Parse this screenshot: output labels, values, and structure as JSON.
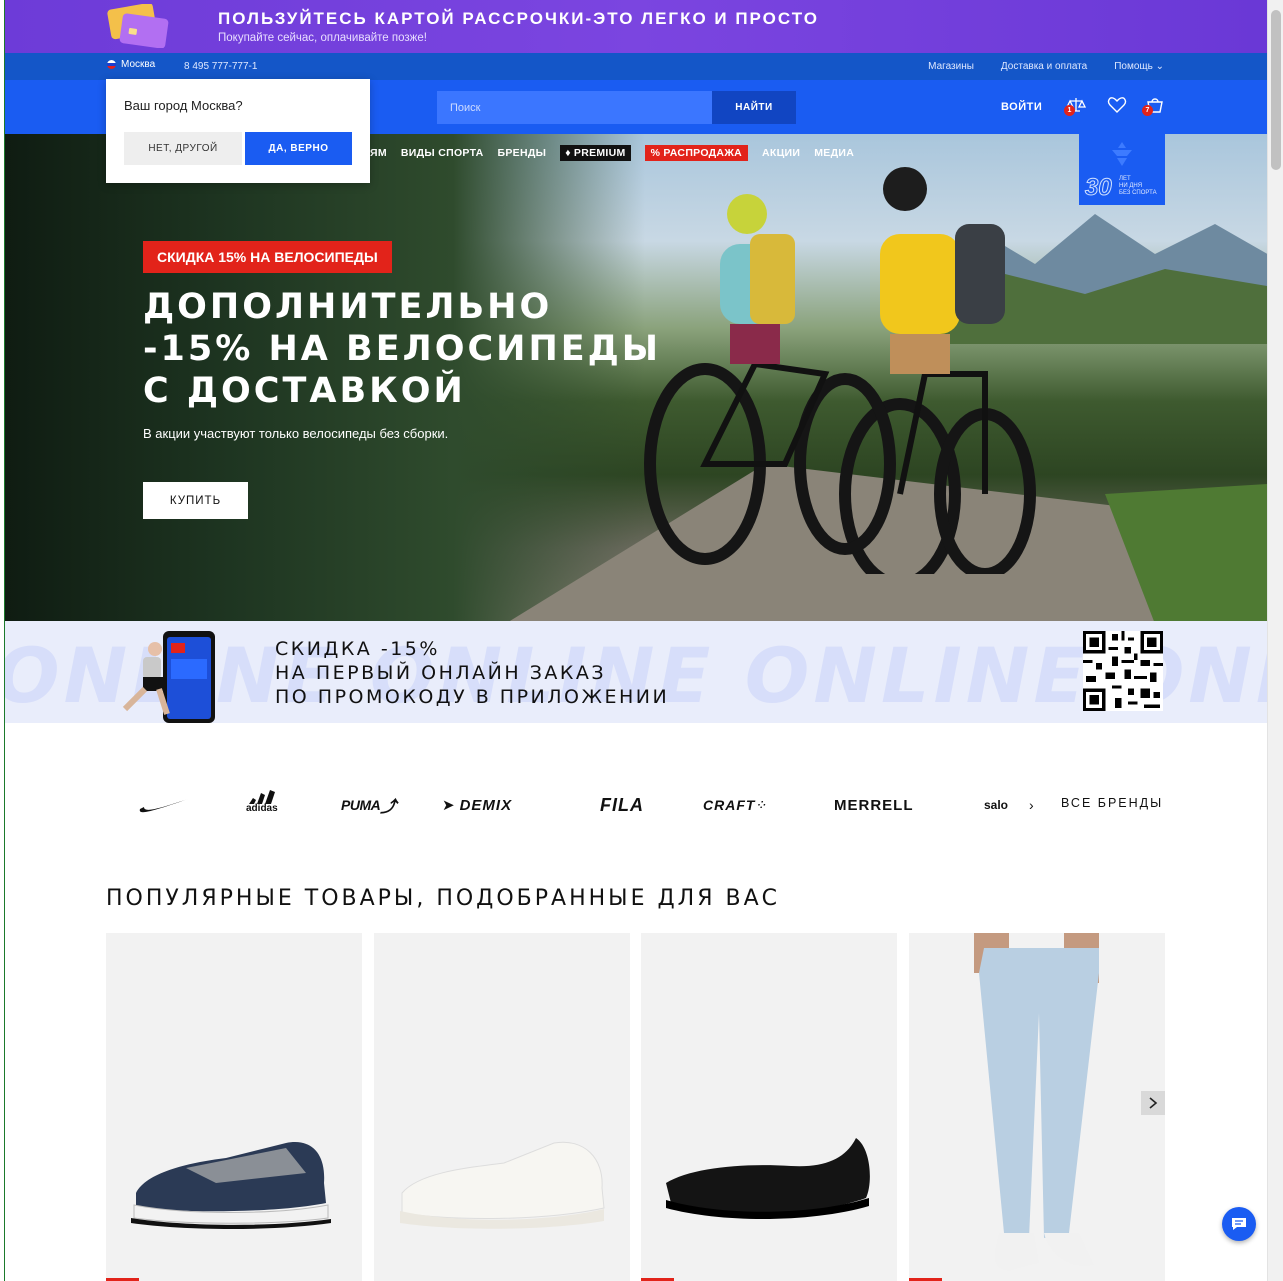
{
  "promo_banner": {
    "title": "ПОЛЬЗУЙТЕСЬ КАРТОЙ РАССРОЧКИ-ЭТО ЛЕГКО И ПРОСТО",
    "subtitle": "Покупайте сейчас, оплачивайте позже!"
  },
  "utility_bar": {
    "city": "Москва",
    "phone": "8 495 777-777-1",
    "links": [
      "Магазины",
      "Доставка и оплата",
      "Помощь"
    ]
  },
  "header": {
    "search_placeholder": "Поиск",
    "search_button": "НАЙТИ",
    "login": "ВОЙТИ",
    "compare_count": "1",
    "cart_count": "7"
  },
  "city_popup": {
    "question": "Ваш город Москва?",
    "no_button": "НЕТ, ДРУГОЙ",
    "yes_button": "ДА, ВЕРНО"
  },
  "main_nav": {
    "items": [
      "ЯМ",
      "ВИДЫ СПОРТА",
      "БРЕНДЫ"
    ],
    "premium": "PREMIUM",
    "sale": "% РАСПРОДАЖА",
    "promotions": "АКЦИИ",
    "media": "МЕДИА"
  },
  "anniversary_badge": {
    "number": "30",
    "text": [
      "ЛЕТ",
      "НИ ДНЯ",
      "БЕЗ СПОРТА"
    ]
  },
  "hero": {
    "tag": "СКИДКА 15% НА ВЕЛОСИПЕДЫ",
    "headline": [
      "ДОПОЛНИТЕЛЬНО",
      "-15% НА ВЕЛОСИПЕДЫ",
      "С ДОСТАВКОЙ"
    ],
    "description": "В акции участвуют только велосипеды без сборки.",
    "button": "КУПИТЬ"
  },
  "app_strip": {
    "background_text": "ONLINE ONLINE ONLINE ONLINE ONLINE ONLINE",
    "lines": [
      "СКИДКА -15%",
      "НА ПЕРВЫЙ ОНЛАЙН ЗАКАЗ",
      "ПО ПРОМОКОДУ В ПРИЛОЖЕНИИ"
    ]
  },
  "brands": {
    "items": [
      "nike",
      "adidas",
      "PUMA",
      "DEMIX",
      "FILA",
      "CRAFT",
      "MERRELL",
      "salo"
    ],
    "all_brands": "ВСЕ БРЕНДЫ"
  },
  "popular": {
    "title": "ПОПУЛЯРНЫЕ ТОВАРЫ, ПОДОБРАННЫЕ ДЛЯ ВАС"
  },
  "colors": {
    "brand_blue": "#1a5cf2",
    "accent_red": "#e2231a",
    "promo_purple": "#6d3bd8"
  }
}
